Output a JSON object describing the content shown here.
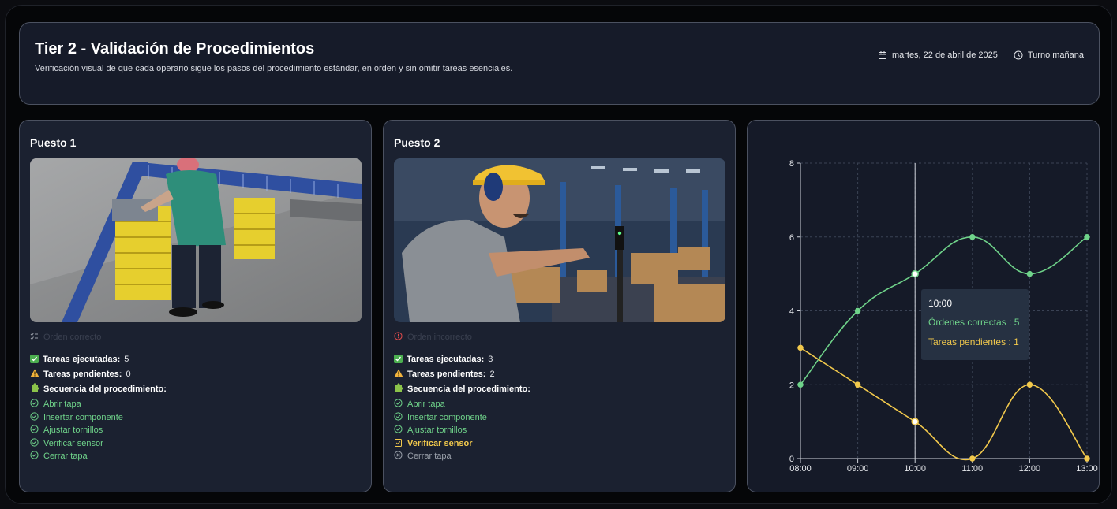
{
  "header": {
    "title": "Tier 2 - Validación de Procedimientos",
    "subtitle": "Verificación visual de que cada operario sigue los pasos del procedimiento estándar, en orden y sin omitir tareas esenciales.",
    "date": "martes, 22 de abril de 2025",
    "shift": "Turno mañana"
  },
  "stations": [
    {
      "title": "Puesto 1",
      "status": "Orden correcto",
      "executed_label": "Tareas ejecutadas:",
      "executed_value": "5",
      "pending_label": "Tareas pendientes:",
      "pending_value": "0",
      "sequence_label": "Secuencia del procedimiento:",
      "steps": [
        "Abrir tapa",
        "Insertar componente",
        "Ajustar tornillos",
        "Verificar sensor",
        "Cerrar tapa"
      ]
    },
    {
      "title": "Puesto 2",
      "status": "Orden incorrecto",
      "executed_label": "Tareas ejecutadas:",
      "executed_value": "3",
      "pending_label": "Tareas pendientes:",
      "pending_value": "2",
      "sequence_label": "Secuencia del procedimiento:",
      "steps": [
        "Abrir tapa",
        "Insertar componente",
        "Ajustar tornillos",
        "Verificar sensor",
        "Cerrar tapa"
      ]
    }
  ],
  "colors": {
    "green": "#6fd38a",
    "yellow": "#f2c94c",
    "card": "#1b2130",
    "border": "#4b5160"
  },
  "chart_data": {
    "type": "line",
    "title": "",
    "x": [
      "08:00",
      "09:00",
      "10:00",
      "11:00",
      "12:00",
      "13:00"
    ],
    "ylim": [
      0,
      8
    ],
    "yticks": [
      "0",
      "2",
      "4",
      "6",
      "8"
    ],
    "grid": true,
    "series": [
      {
        "name": "Órdenes correctas",
        "color": "#6fd38a",
        "values": [
          2,
          4,
          5,
          6,
          5,
          6
        ]
      },
      {
        "name": "Tareas pendientes",
        "color": "#f2c94c",
        "values": [
          3,
          2,
          1,
          0,
          2,
          0
        ]
      }
    ],
    "tooltip": {
      "time": "10:00",
      "line1": "Órdenes correctas : 5",
      "line2": "Tareas pendientes : 1"
    }
  }
}
